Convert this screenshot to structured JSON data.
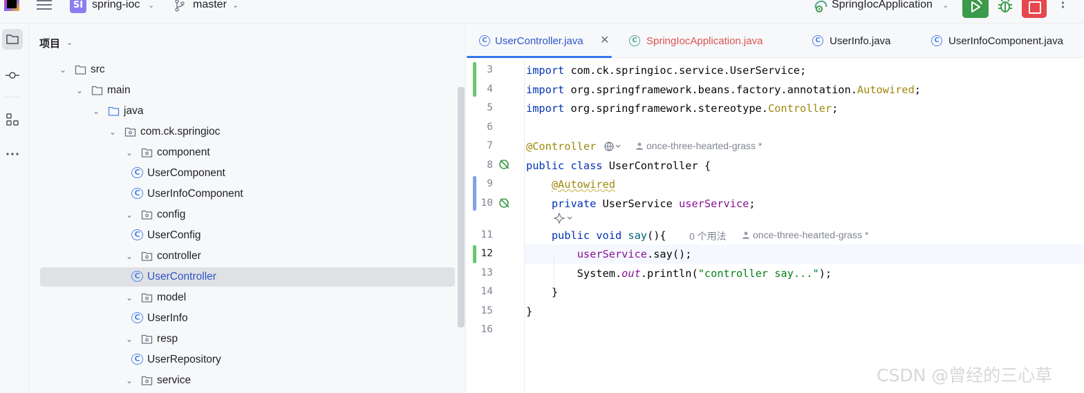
{
  "titlebar": {
    "project_badge": "SI",
    "project_name": "spring-ioc",
    "branch": "master",
    "run_config": "SpringIocApplication"
  },
  "project_panel": {
    "title": "项目",
    "tree": [
      {
        "label": "src",
        "type": "folder",
        "depth": 0,
        "expanded": true
      },
      {
        "label": "main",
        "type": "folder",
        "depth": 1,
        "expanded": true
      },
      {
        "label": "java",
        "type": "source-folder",
        "depth": 2,
        "expanded": true
      },
      {
        "label": "com.ck.springioc",
        "type": "package",
        "depth": 3,
        "expanded": true
      },
      {
        "label": "component",
        "type": "package",
        "depth": 4,
        "expanded": true
      },
      {
        "label": "UserComponent",
        "type": "class",
        "depth": 5
      },
      {
        "label": "UserInfoComponent",
        "type": "class",
        "depth": 5
      },
      {
        "label": "config",
        "type": "package",
        "depth": 4,
        "expanded": true
      },
      {
        "label": "UserConfig",
        "type": "class",
        "depth": 5
      },
      {
        "label": "controller",
        "type": "package",
        "depth": 4,
        "expanded": true
      },
      {
        "label": "UserController",
        "type": "class",
        "depth": 5,
        "selected": true
      },
      {
        "label": "model",
        "type": "package",
        "depth": 4,
        "expanded": true
      },
      {
        "label": "UserInfo",
        "type": "class",
        "depth": 5
      },
      {
        "label": "resp",
        "type": "package",
        "depth": 4,
        "expanded": true
      },
      {
        "label": "UserRepository",
        "type": "class",
        "depth": 5
      },
      {
        "label": "service",
        "type": "package",
        "depth": 4,
        "expanded": true
      }
    ]
  },
  "tabs": [
    {
      "label": "UserController.java",
      "active": true
    },
    {
      "label": "SpringIocApplication.java",
      "error": true
    },
    {
      "label": "UserInfo.java"
    },
    {
      "label": "UserInfoComponent.java"
    }
  ],
  "editor": {
    "current_line": 12,
    "lines": [
      {
        "n": "3",
        "text": "import com.ck.springioc.service.UserService;"
      },
      {
        "n": "4",
        "text": "import org.springframework.beans.factory.annotation.Autowired;"
      },
      {
        "n": "5",
        "text": "import org.springframework.stereotype.Controller;"
      },
      {
        "n": "6",
        "text": ""
      },
      {
        "n": "7",
        "text": "@Controller"
      },
      {
        "n": "8",
        "text": "public class UserController {"
      },
      {
        "n": "9",
        "text": "@Autowired"
      },
      {
        "n": "10",
        "text": "private UserService userService;"
      },
      {
        "n": "11",
        "text": "public void say(){"
      },
      {
        "n": "12",
        "text": "userService.say();"
      },
      {
        "n": "13",
        "text": "System.out.println(\"controller say...\");"
      },
      {
        "n": "14",
        "text": "}"
      },
      {
        "n": "15",
        "text": "}"
      },
      {
        "n": "16",
        "text": ""
      }
    ],
    "inlay_author": "once-three-hearted-grass *",
    "inlay_usages": "0 个用法",
    "inlay_author_2": "once-three-hearted-grass *"
  },
  "watermark": "CSDN @曾经的三心草",
  "colors": {
    "accent": "#3574f0",
    "keyword": "#0033b3",
    "annotation": "#9e880d",
    "field": "#871094",
    "string": "#067d17",
    "added": "#68c76e",
    "modified": "#7fa2e8",
    "run": "#3c9a4c",
    "stop": "#e5484d"
  }
}
